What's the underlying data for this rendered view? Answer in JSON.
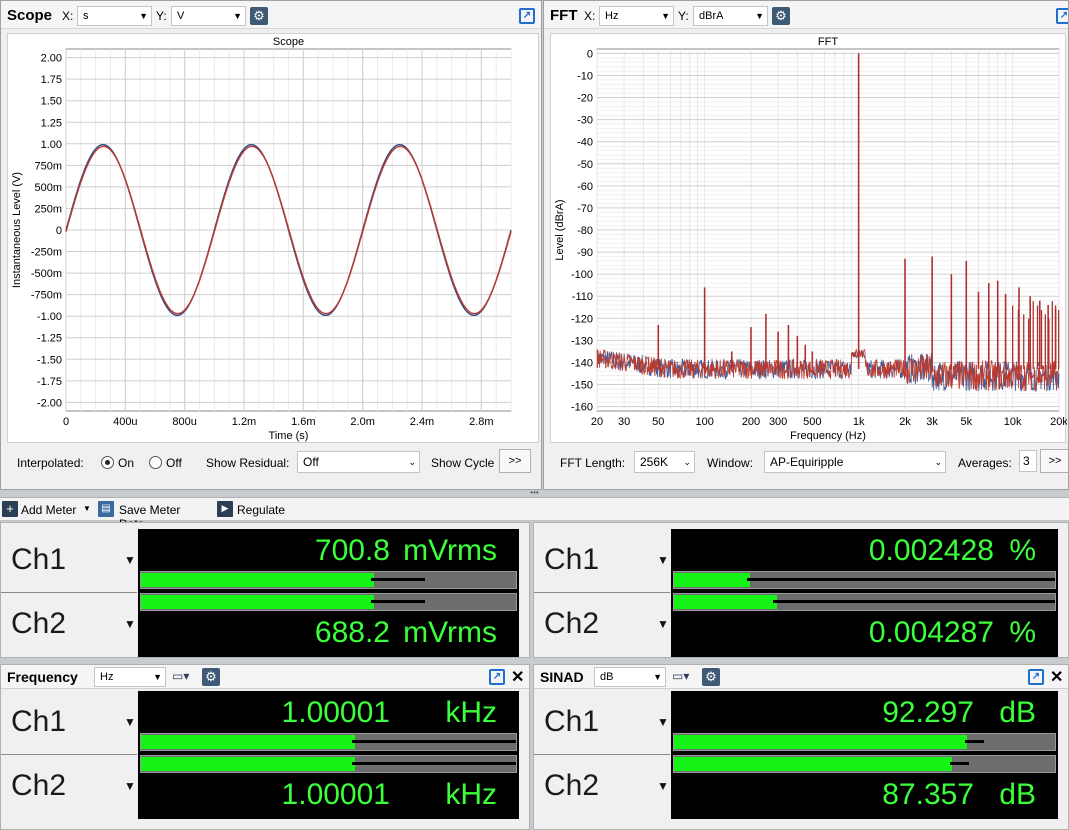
{
  "scope": {
    "title": "Scope",
    "x_label": "X:",
    "x_unit": "s",
    "y_label": "Y:",
    "y_unit": "V",
    "plot_title": "Scope",
    "interpolated_label": "Interpolated:",
    "on_label": "On",
    "off_label": "Off",
    "show_residual_label": "Show Residual:",
    "show_residual_value": "Off",
    "show_cycle_label": "Show Cycle",
    "expand_label": ">>"
  },
  "fft": {
    "title": "FFT",
    "x_label": "X:",
    "x_unit": "Hz",
    "y_label": "Y:",
    "y_unit": "dBrA",
    "plot_title": "FFT",
    "fft_length_label": "FFT Length:",
    "fft_length_value": "256K",
    "window_label": "Window:",
    "window_value": "AP-Equiripple",
    "averages_label": "Averages:",
    "averages_value": "3",
    "expand_label": ">>"
  },
  "toolbar": {
    "add_meter": "Add Meter",
    "save_meter_data": "Save Meter Data",
    "regulate": "Regulate"
  },
  "meters": {
    "level": {
      "ch1_label": "Ch1",
      "ch2_label": "Ch2",
      "ch1_value": "700.8",
      "ch2_value": "688.2",
      "unit": "mVrms",
      "ch1_fill": 0.62,
      "ch2_fill": 0.62
    },
    "thdn": {
      "ch1_label": "Ch1",
      "ch2_label": "Ch2",
      "ch1_value": "0.002428",
      "ch2_value": "0.004287",
      "unit": "%",
      "ch1_fill": 0.2,
      "ch2_fill": 0.27
    },
    "frequency": {
      "title": "Frequency",
      "unit_select": "Hz",
      "ch1_label": "Ch1",
      "ch2_label": "Ch2",
      "ch1_value": "1.00001",
      "ch2_value": "1.00001",
      "unit": "kHz",
      "ch1_fill": 0.57,
      "ch2_fill": 0.57
    },
    "sinad": {
      "title": "SINAD",
      "unit_select": "dB",
      "ch1_label": "Ch1",
      "ch2_label": "Ch2",
      "ch1_value": "92.297",
      "ch2_value": "87.357",
      "unit": "dB",
      "ch1_fill": 0.77,
      "ch2_fill": 0.73
    }
  },
  "chart_data": [
    {
      "type": "line",
      "title": "Scope",
      "xlabel": "Time (s)",
      "ylabel": "Instantaneous Level (V)",
      "xticks": [
        "0",
        "400u",
        "800u",
        "1.2m",
        "1.6m",
        "2.0m",
        "2.4m",
        "2.8m"
      ],
      "yticks": [
        "2.00",
        "1.75",
        "1.50",
        "1.25",
        "1.00",
        "750m",
        "500m",
        "250m",
        "0",
        "-250m",
        "-500m",
        "-750m",
        "-1.00",
        "-1.25",
        "-1.50",
        "-1.75",
        "-2.00"
      ],
      "xlim": [
        0,
        0.003
      ],
      "ylim": [
        -2.1,
        2.1
      ],
      "series": [
        {
          "color": "#2d4a8c",
          "amplitude": 0.99,
          "frequency_hz": 1000
        },
        {
          "color": "#c0392b",
          "amplitude": 0.97,
          "frequency_hz": 1000
        }
      ],
      "grid": true
    },
    {
      "type": "line",
      "title": "FFT",
      "xlabel": "Frequency (Hz)",
      "ylabel": "Level (dBrA)",
      "xticks": [
        "20",
        "30",
        "50",
        "100",
        "200",
        "300",
        "500",
        "1k",
        "2k",
        "3k",
        "5k",
        "10k",
        "20k"
      ],
      "yticks": [
        "0",
        "-10",
        "-20",
        "-30",
        "-40",
        "-50",
        "-60",
        "-70",
        "-80",
        "-90",
        "-100",
        "-110",
        "-120",
        "-130",
        "-140",
        "-150",
        "-160"
      ],
      "xlim": [
        20,
        20000
      ],
      "ylim": [
        -162,
        2
      ],
      "xscale": "log",
      "noise_floor_db": -143,
      "peaks": [
        {
          "f": 50,
          "db": -123
        },
        {
          "f": 100,
          "db": -106
        },
        {
          "f": 150,
          "db": -135
        },
        {
          "f": 200,
          "db": -124
        },
        {
          "f": 250,
          "db": -118
        },
        {
          "f": 300,
          "db": -126
        },
        {
          "f": 350,
          "db": -123
        },
        {
          "f": 400,
          "db": -128
        },
        {
          "f": 450,
          "db": -132
        },
        {
          "f": 500,
          "db": -135
        },
        {
          "f": 1000,
          "db": 0
        },
        {
          "f": 2000,
          "db": -93
        },
        {
          "f": 3000,
          "db": -92
        },
        {
          "f": 4000,
          "db": -100
        },
        {
          "f": 5000,
          "db": -94
        },
        {
          "f": 6000,
          "db": -108
        },
        {
          "f": 7000,
          "db": -104
        },
        {
          "f": 8000,
          "db": -103
        },
        {
          "f": 9000,
          "db": -109
        },
        {
          "f": 11000,
          "db": -106
        },
        {
          "f": 13000,
          "db": -110
        },
        {
          "f": 15000,
          "db": -112
        },
        {
          "f": 17000,
          "db": -114
        },
        {
          "f": 19000,
          "db": -116
        }
      ],
      "series_colors": [
        "#2d4a8c",
        "#c0392b"
      ],
      "grid": true
    }
  ]
}
